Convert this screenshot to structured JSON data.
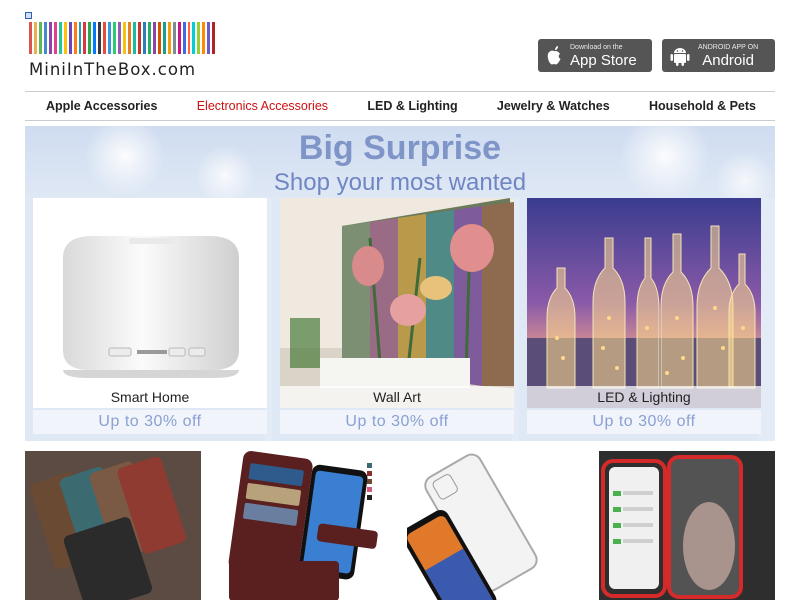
{
  "header": {
    "logo_text": "MiniInTheBox.com",
    "logo_stripe_colors": [
      "#d9534f",
      "#f0ad4e",
      "#5cb85c",
      "#428bca",
      "#8e44ad",
      "#e83e8c",
      "#20c997",
      "#ffc107",
      "#6f42c1",
      "#fd7e14",
      "#17a2b8",
      "#dc3545",
      "#28a745",
      "#007bff",
      "#343a40",
      "#e74c3c",
      "#3498db",
      "#2ecc71",
      "#9b59b6",
      "#f1c40f",
      "#e67e22",
      "#1abc9c",
      "#c0392b",
      "#2980b9",
      "#27ae60",
      "#8e44ad",
      "#d35400",
      "#16a085",
      "#f39c12",
      "#7f8c8d",
      "#c71585",
      "#4169e1",
      "#ff6347",
      "#00ced1",
      "#9acd32",
      "#ff8c00",
      "#6a5acd",
      "#b22222"
    ],
    "app_store": {
      "small": "Download on the",
      "big": "App Store"
    },
    "android": {
      "small": "ANDROID APP ON",
      "big": "Android"
    }
  },
  "nav": {
    "items": [
      {
        "label": "Apple Accessories"
      },
      {
        "label": "Electronics Accessories"
      },
      {
        "label": "LED & Lighting"
      },
      {
        "label": "Jewelry & Watches"
      },
      {
        "label": "Household & Pets"
      }
    ],
    "active_color": "#cc1111"
  },
  "banner": {
    "title": "Big Surprise",
    "subtitle": "Shop your most wanted",
    "cards": [
      {
        "label": "Smart Home",
        "promo": "Up to 30% off"
      },
      {
        "label": "Wall Art",
        "promo": "Up to 30% off"
      },
      {
        "label": "LED & Lighting",
        "promo": "Up to 30% off"
      }
    ],
    "accent_color": "#7f95c8"
  },
  "products": [
    {
      "icon": "leather-wallet-cases-image"
    },
    {
      "icon": "wallet-phone-case-image"
    },
    {
      "icon": "clear-phone-case-image"
    },
    {
      "icon": "magnetic-metal-case-image"
    }
  ]
}
